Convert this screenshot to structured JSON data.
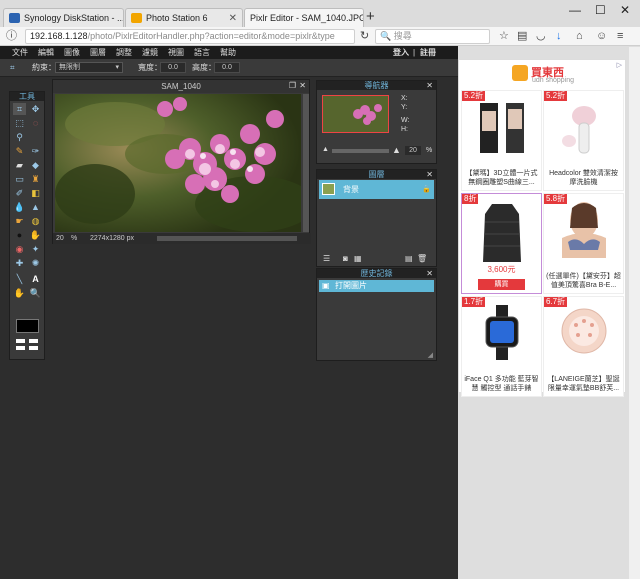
{
  "tabs": [
    {
      "title": "Synology DiskStation - ...",
      "favcolor": "#2b63b1"
    },
    {
      "title": "Photo Station 6",
      "favcolor": "#f2a500"
    },
    {
      "title": "Pixlr Editor - SAM_1040.JPG",
      "favcolor": "#3a9ad9"
    }
  ],
  "url": {
    "host": "192.168.1.128",
    "path": "/photo/PixlrEditorHandler.php?action=editor&mode=pixlr&type"
  },
  "search_placeholder": "搜尋",
  "menu": [
    "文件",
    "編輯",
    "圖像",
    "圖層",
    "調整",
    "濾鏡",
    "視圖",
    "語言",
    "幫助"
  ],
  "auth": {
    "login": "登入",
    "separator": "|",
    "register": "註冊"
  },
  "options": {
    "constraint_label": "約束：",
    "constraint_value": "無限制",
    "width_label": "寬度：",
    "width_value": "0.0",
    "height_label": "高度：",
    "height_value": "0.0"
  },
  "tools_title": "工具",
  "canvas": {
    "title": "SAM_1040",
    "zoom": "20",
    "zoom_unit": "%",
    "size": "2274x1280 px"
  },
  "navigator": {
    "title": "導航器",
    "x_label": "X:",
    "y_label": "Y:",
    "w_label": "W:",
    "h_label": "H:",
    "zoom": "20",
    "unit": "%"
  },
  "layers": {
    "title": "圖層",
    "items": [
      "背景"
    ]
  },
  "history": {
    "title": "歷史記錄",
    "items": [
      "打開圖片"
    ]
  },
  "ad": {
    "brand": "買東西",
    "brand_sub": "udn shopping",
    "items": [
      {
        "tag": "5.2折",
        "caption": "【黛瑪】3D立體一片式無鋼圈雕塑S曲線三..."
      },
      {
        "tag": "5.2折",
        "caption": "Headcolor 雙效清潔按摩洗臉機"
      },
      {
        "tag": "8折",
        "caption": "",
        "price": "3,600元",
        "buy": "購買"
      },
      {
        "tag": "5.8折",
        "caption": "(任選單件)【黛安芬】超值美頂驚喜Bra B-E..."
      },
      {
        "tag": "1.7折",
        "caption": "iFace Q1 多功能 藍芽智慧 觸控型 通話手錶"
      },
      {
        "tag": "6.7折",
        "caption": "【LANEIGE蘭芝】聖誕限量幸運氣墊BB舒芙..."
      }
    ]
  }
}
